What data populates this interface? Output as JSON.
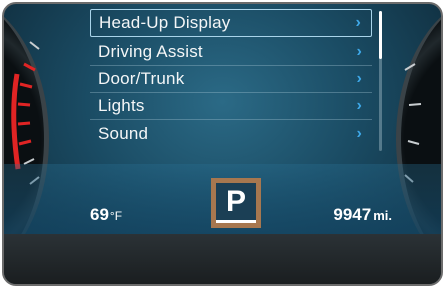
{
  "menu": {
    "items": [
      {
        "label": "Head-Up Display",
        "selected": true
      },
      {
        "label": "Driving Assist",
        "selected": false
      },
      {
        "label": "Door/Trunk",
        "selected": false
      },
      {
        "label": "Lights",
        "selected": false
      },
      {
        "label": "Sound",
        "selected": false
      }
    ],
    "chevron": "›"
  },
  "status": {
    "temperature_value": "69",
    "temperature_unit": "°F",
    "odometer_value": "9947",
    "odometer_unit": "mi."
  },
  "gear": {
    "current": "P"
  },
  "colors": {
    "accent_chevron": "#3ea8e8",
    "gear_frame": "#a7774f",
    "redline": "#d62020"
  }
}
